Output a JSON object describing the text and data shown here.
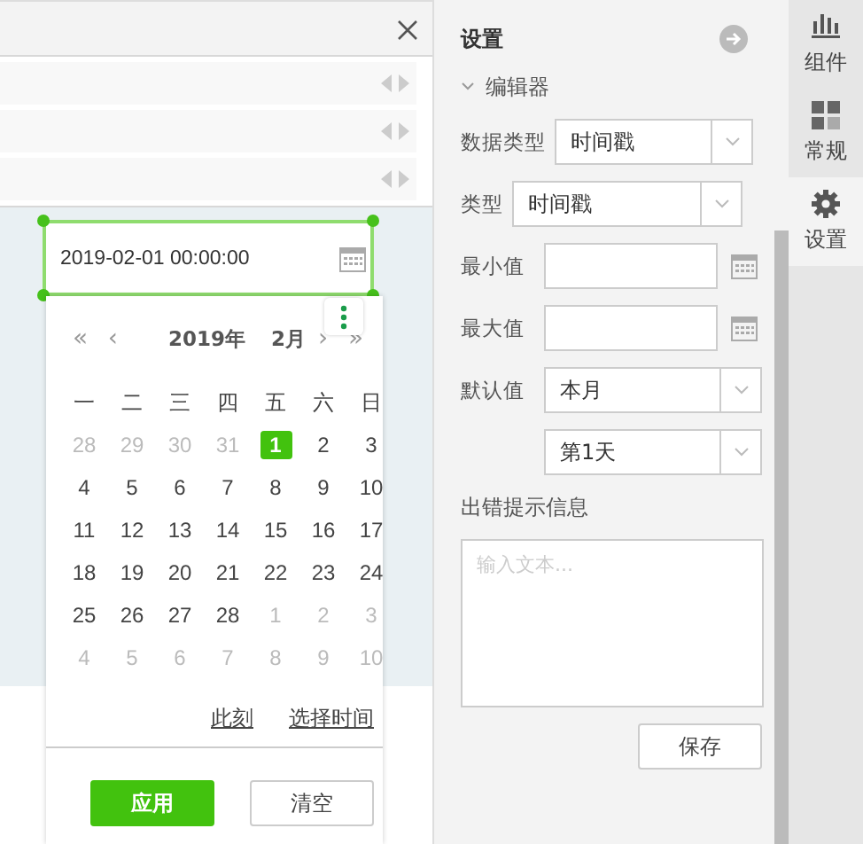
{
  "canvas": {
    "widget": {
      "value": "2019-02-01 00:00:00",
      "selected": true
    }
  },
  "calendar": {
    "year": "2019年",
    "month": "2月",
    "nav": {
      "prev_year": "«",
      "prev_month": "‹",
      "next_month": "›",
      "next_year": "»"
    },
    "weekdays": [
      "一",
      "二",
      "三",
      "四",
      "五",
      "六",
      "日"
    ],
    "days": [
      {
        "label": "28",
        "muted": true,
        "selected": false
      },
      {
        "label": "29",
        "muted": true,
        "selected": false
      },
      {
        "label": "30",
        "muted": true,
        "selected": false
      },
      {
        "label": "31",
        "muted": true,
        "selected": false
      },
      {
        "label": "1",
        "muted": false,
        "selected": true
      },
      {
        "label": "2",
        "muted": false,
        "selected": false
      },
      {
        "label": "3",
        "muted": false,
        "selected": false
      },
      {
        "label": "4",
        "muted": false,
        "selected": false
      },
      {
        "label": "5",
        "muted": false,
        "selected": false
      },
      {
        "label": "6",
        "muted": false,
        "selected": false
      },
      {
        "label": "7",
        "muted": false,
        "selected": false
      },
      {
        "label": "8",
        "muted": false,
        "selected": false
      },
      {
        "label": "9",
        "muted": false,
        "selected": false
      },
      {
        "label": "10",
        "muted": false,
        "selected": false
      },
      {
        "label": "11",
        "muted": false,
        "selected": false
      },
      {
        "label": "12",
        "muted": false,
        "selected": false
      },
      {
        "label": "13",
        "muted": false,
        "selected": false
      },
      {
        "label": "14",
        "muted": false,
        "selected": false
      },
      {
        "label": "15",
        "muted": false,
        "selected": false
      },
      {
        "label": "16",
        "muted": false,
        "selected": false
      },
      {
        "label": "17",
        "muted": false,
        "selected": false
      },
      {
        "label": "18",
        "muted": false,
        "selected": false
      },
      {
        "label": "19",
        "muted": false,
        "selected": false
      },
      {
        "label": "20",
        "muted": false,
        "selected": false
      },
      {
        "label": "21",
        "muted": false,
        "selected": false
      },
      {
        "label": "22",
        "muted": false,
        "selected": false
      },
      {
        "label": "23",
        "muted": false,
        "selected": false
      },
      {
        "label": "24",
        "muted": false,
        "selected": false
      },
      {
        "label": "25",
        "muted": false,
        "selected": false
      },
      {
        "label": "26",
        "muted": false,
        "selected": false
      },
      {
        "label": "27",
        "muted": false,
        "selected": false
      },
      {
        "label": "28",
        "muted": false,
        "selected": false
      },
      {
        "label": "1",
        "muted": true,
        "selected": false
      },
      {
        "label": "2",
        "muted": true,
        "selected": false
      },
      {
        "label": "3",
        "muted": true,
        "selected": false
      },
      {
        "label": "4",
        "muted": true,
        "selected": false
      },
      {
        "label": "5",
        "muted": true,
        "selected": false
      },
      {
        "label": "6",
        "muted": true,
        "selected": false
      },
      {
        "label": "7",
        "muted": true,
        "selected": false
      },
      {
        "label": "8",
        "muted": true,
        "selected": false
      },
      {
        "label": "9",
        "muted": true,
        "selected": false
      },
      {
        "label": "10",
        "muted": true,
        "selected": false
      }
    ],
    "links": [
      "此刻",
      "选择时间"
    ],
    "buttons": [
      {
        "label": "应用",
        "kind": "primary"
      },
      {
        "label": "清空",
        "kind": "secondary"
      }
    ]
  },
  "settings": {
    "title": "设置",
    "section": {
      "label": "编辑器",
      "expanded": true
    },
    "fields": [
      {
        "kind": "select",
        "label": "数据类型",
        "value": "时间戳"
      },
      {
        "kind": "select",
        "label": "类型",
        "value": "时间戳"
      },
      {
        "kind": "date",
        "label": "最小值"
      },
      {
        "kind": "date",
        "label": "最大值"
      },
      {
        "kind": "select",
        "label": "默认值",
        "value": "本月"
      },
      {
        "kind": "select",
        "value": "第1天"
      }
    ],
    "error_label": "出错提示信息",
    "error_placeholder": "输入文本...",
    "save": "保存"
  },
  "side_tabs": [
    {
      "label": "组件",
      "selected": false
    },
    {
      "label": "常规",
      "selected": false
    },
    {
      "label": "设置",
      "selected": true
    }
  ]
}
